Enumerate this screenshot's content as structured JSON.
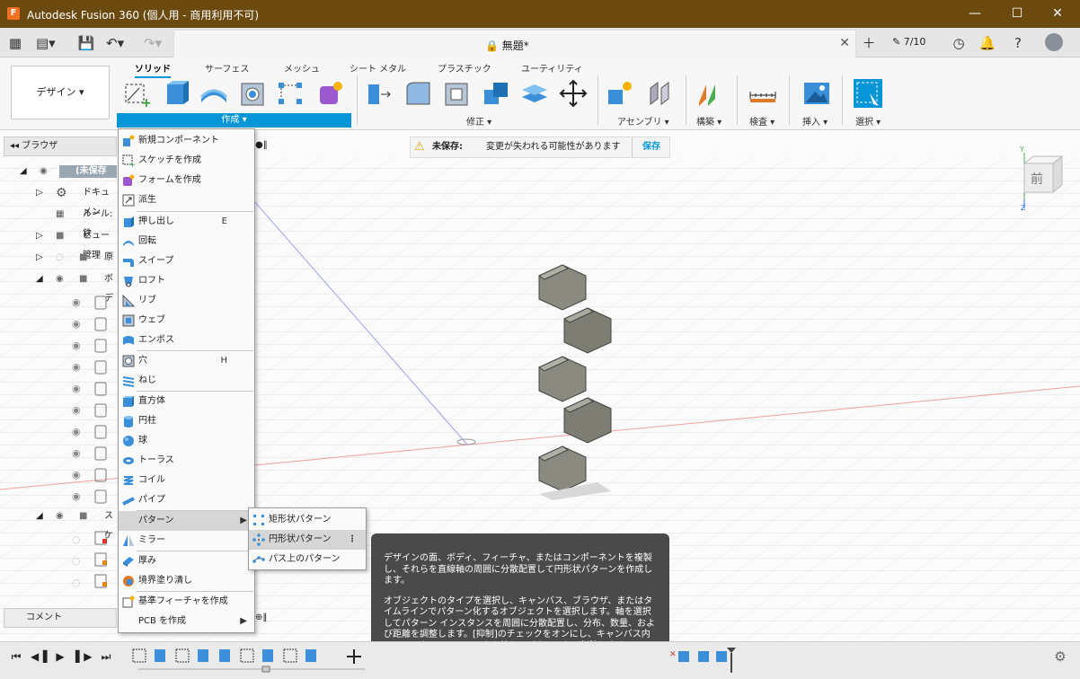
{
  "window": {
    "title": "Autodesk Fusion 360 (個人用 - 商用利用不可)"
  },
  "tabbar": {
    "doc_title": "無題*",
    "job_count": "7/10"
  },
  "ribbon": {
    "workspace": "デザイン",
    "tabs": [
      "ソリッド",
      "サーフェス",
      "メッシュ",
      "シート メタル",
      "プラスチック",
      "ユーティリティ"
    ],
    "groups": {
      "create": "作成",
      "modify": "修正",
      "assemble": "アセンブリ",
      "construct": "構築",
      "inspect": "検査",
      "insert": "挿入",
      "select": "選択"
    }
  },
  "browser": {
    "header": "ブラウザ",
    "root": "(未保存",
    "items": [
      {
        "label": "ドキュメン"
      },
      {
        "label": "ルール: 鉄"
      },
      {
        "label": "ビュー管理"
      },
      {
        "label": "原"
      },
      {
        "label": "ボデ"
      },
      {
        "label": "スケ"
      }
    ],
    "comment": "コメント"
  },
  "notice": {
    "label": "未保存:",
    "message": "変更が失われる可能性があります",
    "save": "保存"
  },
  "create_menu": {
    "items": [
      {
        "label": "新規コンポーネント",
        "shortcut": ""
      },
      {
        "label": "スケッチを作成",
        "shortcut": ""
      },
      {
        "label": "フォームを作成",
        "shortcut": ""
      },
      {
        "label": "派生",
        "shortcut": ""
      },
      {
        "label": "押し出し",
        "shortcut": "E"
      },
      {
        "label": "回転",
        "shortcut": ""
      },
      {
        "label": "スイープ",
        "shortcut": ""
      },
      {
        "label": "ロフト",
        "shortcut": ""
      },
      {
        "label": "リブ",
        "shortcut": ""
      },
      {
        "label": "ウェブ",
        "shortcut": ""
      },
      {
        "label": "エンボス",
        "shortcut": ""
      },
      {
        "label": "穴",
        "shortcut": "H"
      },
      {
        "label": "ねじ",
        "shortcut": ""
      },
      {
        "label": "直方体",
        "shortcut": ""
      },
      {
        "label": "円柱",
        "shortcut": ""
      },
      {
        "label": "球",
        "shortcut": ""
      },
      {
        "label": "トーラス",
        "shortcut": ""
      },
      {
        "label": "コイル",
        "shortcut": ""
      },
      {
        "label": "パイプ",
        "shortcut": ""
      },
      {
        "label": "パターン",
        "shortcut": ""
      },
      {
        "label": "ミラー",
        "shortcut": ""
      },
      {
        "label": "厚み",
        "shortcut": ""
      },
      {
        "label": "境界塗り潰し",
        "shortcut": ""
      },
      {
        "label": "基準フィーチャを作成",
        "shortcut": ""
      },
      {
        "label": "PCB を作成",
        "shortcut": ""
      }
    ]
  },
  "pattern_submenu": {
    "items": [
      "矩形状パターン",
      "円形状パターン",
      "パス上のパターン"
    ]
  },
  "tooltip": {
    "para1": "デザインの面、ボディ、フィーチャ、またはコンポーネントを複製し、それらを直線軸の周囲に分散配置して円形状パターンを作成します。",
    "para2": "オブジェクトのタイプを選択し、キャンバス、ブラウザ、またはタイムラインでパターン化するオブジェクトを選択します。軸を選択してパターン インスタンスを周囲に分散配置し、分布、数量、および距離を調整します。[抑制]のチェックをオンにし、キャンバス内のインスタンスのチェックを外してパターンから削除します。"
  },
  "viewcube": {
    "face": "前",
    "axis_y": "Y",
    "axis_z": "Z"
  },
  "colors": {
    "titlebar": "#6b4a10",
    "accent": "#0696d7",
    "tooltip_bg": "#4a4a4a"
  }
}
